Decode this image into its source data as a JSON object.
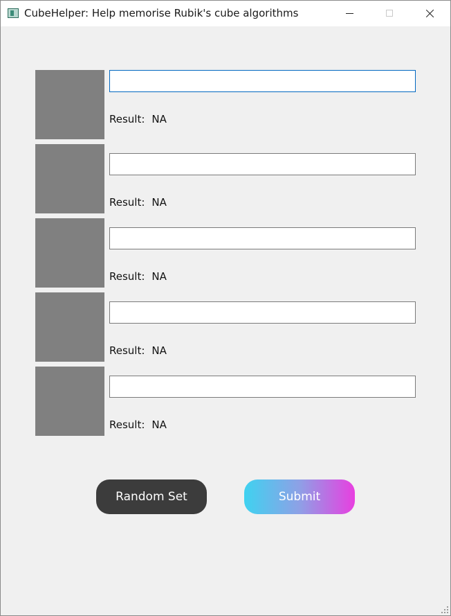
{
  "window": {
    "title": "CubeHelper: Help memorise Rubik's cube algorithms",
    "icon": "app-window-icon",
    "controls": {
      "minimize_icon": "minimize-icon",
      "maximize_icon": "maximize-icon",
      "close_icon": "close-icon"
    }
  },
  "algorithms": [
    {
      "input_value": "",
      "result_label": "Result:",
      "result_value": "NA",
      "focused": true
    },
    {
      "input_value": "",
      "result_label": "Result:",
      "result_value": "NA",
      "focused": false
    },
    {
      "input_value": "",
      "result_label": "Result:",
      "result_value": "NA",
      "focused": false
    },
    {
      "input_value": "",
      "result_label": "Result:",
      "result_value": "NA",
      "focused": false
    },
    {
      "input_value": "",
      "result_label": "Result:",
      "result_value": "NA",
      "focused": false
    }
  ],
  "buttons": {
    "random_set_label": "Random Set",
    "submit_label": "Submit"
  },
  "colors": {
    "cube_placeholder": "#808080",
    "random_button": "#3c3c3c",
    "submit_gradient": [
      "#3fd2f0",
      "#e83fe0"
    ],
    "focus_border": "#0067c0"
  }
}
